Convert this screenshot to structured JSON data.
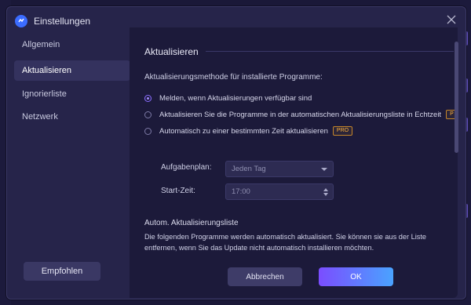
{
  "window": {
    "title": "Einstellungen"
  },
  "sidebar": {
    "items": [
      {
        "label": "Allgemein"
      },
      {
        "label": "Aktualisieren"
      },
      {
        "label": "Ignorierliste"
      },
      {
        "label": "Netzwerk"
      }
    ],
    "active_index": 1,
    "recommend_label": "Empfohlen"
  },
  "content": {
    "section_title": "Aktualisieren",
    "method_label": "Aktualisierungsmethode für installierte Programme:",
    "options": [
      {
        "label": "Melden, wenn Aktualisierungen verfügbar sind",
        "checked": true,
        "pro": ""
      },
      {
        "label": "Aktualisieren Sie die Programme in der automatischen Aktualisierungsliste in Echtzeit",
        "checked": false,
        "pro": "P"
      },
      {
        "label": "Automatisch zu einer bestimmten Zeit aktualisieren",
        "checked": false,
        "pro": "PRO"
      }
    ],
    "schedule": {
      "label": "Aufgabenplan:",
      "value": "Jeden Tag"
    },
    "start_time": {
      "label": "Start-Zeit:",
      "value": "17:00"
    },
    "list_title": "Autom. Aktualisierungsliste",
    "list_desc": "Die folgenden Programme werden automatisch aktualisiert. Sie können sie aus der Liste entfernen, wenn Sie das Update nicht automatisch installieren möchten."
  },
  "footer": {
    "cancel_label": "Abbrechen",
    "ok_label": "OK"
  },
  "colors": {
    "accent_start": "#7b4dff",
    "accent_end": "#4aa3ff",
    "pro_badge": "#ffb23a"
  },
  "icons": {
    "logo": "app-logo-icon",
    "close": "close-icon",
    "caret": "chevron-down-icon",
    "spinner": "spinner-arrows-icon"
  }
}
